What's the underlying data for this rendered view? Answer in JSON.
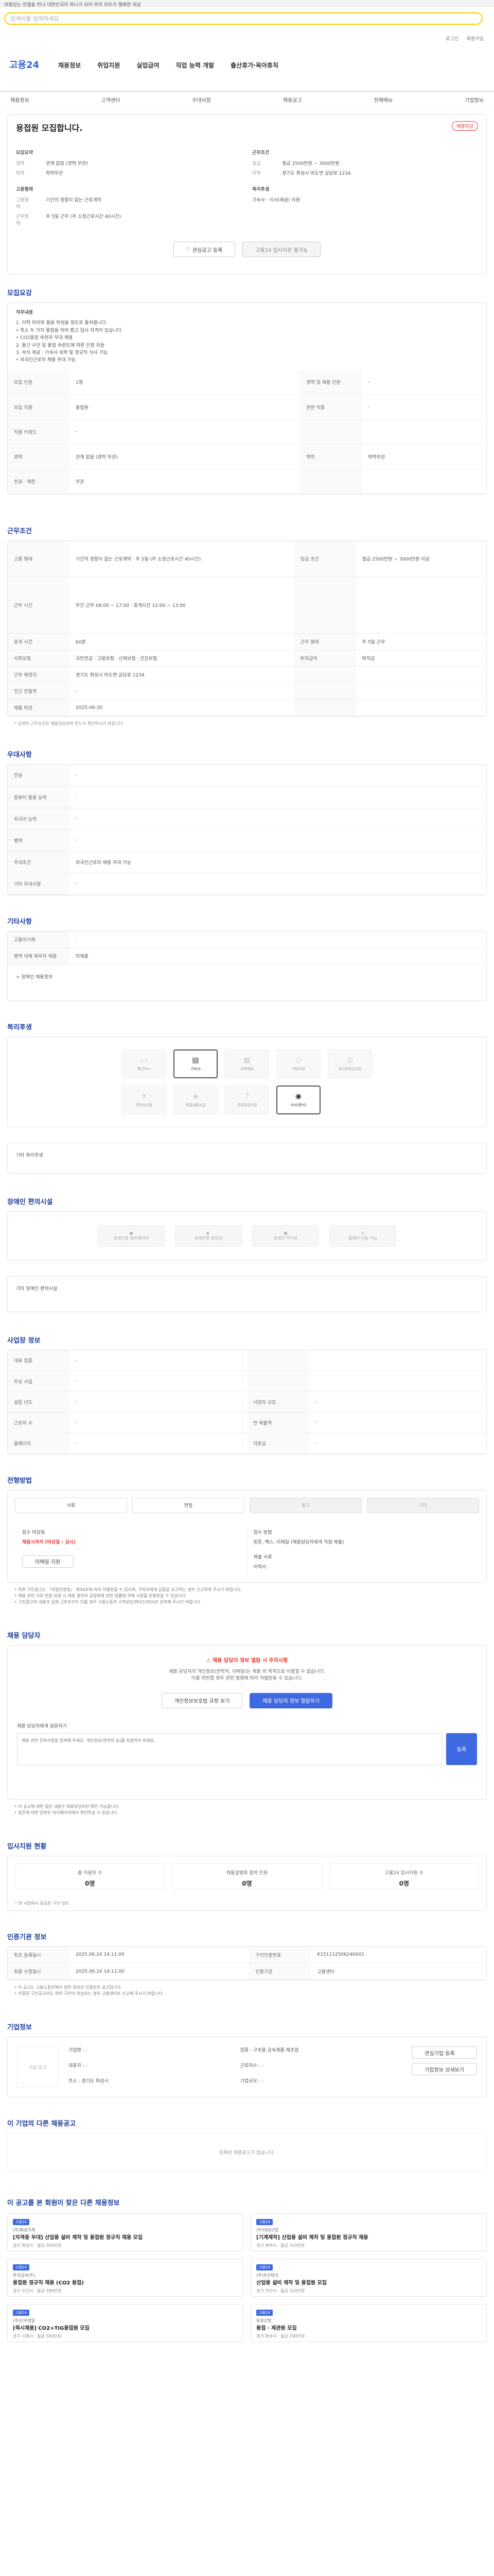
{
  "notice": "보람있는 연결을 만나 대한민국이 하나가 되어 우리 모두가 행복한 세상",
  "search": {
    "placeholder": "검색어를 입력하세요"
  },
  "util": [
    "로그인",
    "회원가입"
  ],
  "nav": {
    "logo": "고용24",
    "items": [
      "채용정보",
      "취업지원",
      "실업급여",
      "직업 능력 개발",
      "출산휴가·육아휴직"
    ],
    "sub": [
      "채용정보",
      "고객센터",
      "우대사항",
      "채용공고",
      "전체메뉴",
      "기업정보"
    ]
  },
  "summary": {
    "title": "용접원 모집합니다.",
    "badge": "채용마감",
    "left_head": "모집요약",
    "right_head": "근무조건",
    "left": [
      {
        "k": "경력",
        "v": "관계 없음 (경력 무관)"
      },
      {
        "k": "학력",
        "v": "학력무관"
      }
    ],
    "right": [
      {
        "k": "임금",
        "v": "월급 2500만원 ~ 3000만원"
      },
      {
        "k": "지역",
        "v": "경기도 화성시 마도면 금당로 1234"
      }
    ],
    "left2_head": "고용형태",
    "right2_head": "복리후생",
    "left2": [
      {
        "k": "고용형태",
        "v": "기간의 정함이 없는 근로계약"
      },
      {
        "k": "근무형태",
        "v": "주 5일 근무 (주 소정근로시간 40시간)"
      }
    ],
    "right2": [
      {
        "k": "",
        "v": "기숙사 · 식사(제공) 지원"
      }
    ],
    "btn_save": "관심공고 등록",
    "btn_apply": "고용24 입사지원 불가능"
  },
  "recruit": {
    "title": "모집요강",
    "body": [
      "직무내용",
      "1. 이력 허리와 몸을 뒤섞을 정도로 들쳐봅니다.",
      "• 최소 두 가지 용접을 하여 봤고 입사 자격이 있습니다.",
      "• CO2용접 숙련자 우대 채용",
      "2. 통근 수단 및 용접 숙련도에 따른 인정 차등",
      "3. 숙식 제공 : 기숙사 숙박 및 정규직 식사 가능",
      "• 외국인근로자 채용 우대 가능"
    ],
    "rows": [
      {
        "k1": "모집 인원",
        "v1": "1명",
        "k2": "경력 및 채용 인원",
        "v2": "-"
      },
      {
        "k1": "모집 직종",
        "v1": "용접원",
        "k2": "관련 직종",
        "v2": "-"
      },
      {
        "k1": "직종 키워드",
        "v1": "-",
        "k2": "",
        "v2": ""
      },
      {
        "k1": "경력",
        "v1": "관계 없음 (경력 무관)",
        "k2": "학력",
        "v2": "학력무관"
      },
      {
        "k1": "전공 · 제한",
        "v1": "무관",
        "k2": "",
        "v2": ""
      }
    ]
  },
  "conditions": {
    "title": "근무조건",
    "rows": [
      {
        "k1": "고용 형태",
        "v1": "기간의 정함이 없는 근로계약 · 주 5일 (주 소정근로시간 40시간)",
        "k2": "임금 조건",
        "v2": "월급 2500만원 ~ 3000만원 이상"
      },
      {
        "k1": "근무 시간",
        "v1": "주간 근무 08:00 ~ 17:00 · 휴게시간 12:00 ~ 13:00",
        "k2": "",
        "v2": ""
      },
      {
        "k1": "휴게 시간",
        "v1": "60분",
        "k2": "근무 형태",
        "v2": "주 5일 근무"
      },
      {
        "k1": "사회보험",
        "v1": "국민연금 · 고용보험 · 산재보험 · 건강보험",
        "k2": "퇴직급여",
        "v2": "퇴직금"
      },
      {
        "k1": "근무 예정지",
        "v1": "경기도 화성시 마도면 금당로 1234",
        "k2": "",
        "v2": ""
      },
      {
        "k1": "인근 전철역",
        "v1": "-",
        "k2": "",
        "v2": ""
      },
      {
        "k1": "채용 마감",
        "v1": "2025-06-30",
        "k2": "",
        "v2": ""
      }
    ],
    "note": "* 상세한 근무조건은 채용담당자와 반드시 확인하시기 바랍니다."
  },
  "preference": {
    "title": "우대사항",
    "rows": [
      {
        "k": "전공",
        "v": "-"
      },
      {
        "k": "컴퓨터 활용 능력",
        "v": "-"
      },
      {
        "k": "외국어 능력",
        "v": "-"
      },
      {
        "k": "병역",
        "v": "-"
      },
      {
        "k": "우대조건",
        "v": "외국인근로자 채용 우대 가능"
      },
      {
        "k": "기타 우대사항",
        "v": "-"
      }
    ]
  },
  "etc": {
    "title": "기타사항",
    "rows": [
      {
        "k": "고용허가제",
        "v": "-"
      },
      {
        "k": "병역 대체 복무자 채용",
        "v": "미채용"
      }
    ],
    "more": "+ 장애인 채용정보"
  },
  "welfare": {
    "title": "복리후생",
    "tiles": [
      {
        "icon": "car-icon",
        "glyph": "▭",
        "label": "통근버스",
        "on": false
      },
      {
        "icon": "bed-icon",
        "glyph": "▤",
        "label": "기숙사",
        "on": true
      },
      {
        "icon": "building-icon",
        "glyph": "▦",
        "label": "사택제공",
        "on": false
      },
      {
        "icon": "shield-icon",
        "glyph": "◇",
        "label": "식대지원",
        "on": false
      },
      {
        "icon": "person-icon",
        "glyph": "◎",
        "label": "자녀학자금지원",
        "on": false
      },
      {
        "icon": "plane-icon",
        "glyph": "✈",
        "label": "경조사지원",
        "on": false
      },
      {
        "icon": "gift-icon",
        "glyph": "◈",
        "label": "명절선물지급",
        "on": false
      },
      {
        "icon": "question-icon",
        "glyph": "?",
        "label": "건강검진지원",
        "on": false
      },
      {
        "icon": "meal-icon",
        "glyph": "◉",
        "label": "식사(중식)",
        "on": true
      }
    ],
    "detail_label": "기타 복리후생"
  },
  "accessibility": {
    "title": "장애인 편의시설",
    "tiles": [
      {
        "icon": "elevator-icon",
        "glyph": "▣",
        "label": "장애인용 엘리베이터"
      },
      {
        "icon": "toilet-icon",
        "glyph": "◐",
        "label": "장애인용 화장실"
      },
      {
        "icon": "parking-icon",
        "glyph": "▩",
        "label": "장애인 주차장"
      },
      {
        "icon": "wheelchair-icon",
        "glyph": "♿",
        "label": "휠체어 이동 가능"
      }
    ],
    "detail_label": "기타 장애인 편의시설"
  },
  "workplace": {
    "title": "사업장 정보",
    "rows": [
      {
        "k1": "대표 업종",
        "v1": "-",
        "k2": "",
        "v2": ""
      },
      {
        "k1": "주요 사업",
        "v1": "-",
        "k2": "",
        "v2": ""
      },
      {
        "k1": "설립 년도",
        "v1": "-",
        "k2": "사업자 규모",
        "v2": "-"
      },
      {
        "k1": "근로자 수",
        "v1": "-",
        "k2": "연 매출액",
        "v2": "-"
      },
      {
        "k1": "홈페이지",
        "v1": "-",
        "k2": "자본금",
        "v2": "-"
      }
    ]
  },
  "apply": {
    "title": "전형방법",
    "chips": [
      {
        "label": "서류",
        "off": false
      },
      {
        "label": "면접",
        "off": false
      },
      {
        "label": "필기",
        "off": true
      },
      {
        "label": "기타",
        "off": true
      }
    ],
    "col1_head": "접수 마감일",
    "col1_val": "채용시까지 (마감일 : 상시)",
    "col1_btn": "이메일 지원",
    "col2_head": "접수 방법",
    "col2_val": "방문, 팩스, 이메일 (채용담당자에게 직접 제출)",
    "col3_head": "제출 서류",
    "col3_val": "이력서",
    "bullets": [
      "• 허위 구인광고는 「직업안정법」 제34조에 따라 처벌받을 수 있으며, 구직자에게 금품을 요구하는 경우 신고하여 주시기 바랍니다.",
      "• 채용 관련 서류 반환 요청 시 채용 절차의 공정화에 관한 법률에 의해 서류를 반환받을 수 있습니다.",
      "• 구인광고의 내용과 실제 근로조건이 다를 경우 고용노동부 고객상담센터(1350)로 문의해 주시기 바랍니다."
    ]
  },
  "manager": {
    "title": "채용 담당자",
    "alert": "채용 담당자 정보 열람 시 주의사항",
    "sub1": "채용 담당자의 개인정보(연락처, 이메일)는 채용 외 목적으로 이용할 수 없습니다.",
    "sub2": "이를 위반할 경우 관련 법령에 따라 처벌받을 수 있습니다.",
    "btn1": "개인정보보호법 규정 보기",
    "btn2": "채용 담당자 정보 열람하기",
    "qna_label": "채용 담당자에게 질문하기",
    "qna_placeholder": "채용 관련 문의사항을 입력해 주세요. 개인정보(연락처 등)를 포함하지 마세요.",
    "qna_btn": "등록",
    "bullets": [
      "• 이 공고에 대한 질문 내용은 채용담당자만 확인 가능합니다.",
      "• 질문에 대한 답변은 마이페이지에서 확인하실 수 있습니다."
    ]
  },
  "status": {
    "title": "입사지원 현황",
    "stats": [
      {
        "label": "총 지원자 수",
        "value": "0명"
      },
      {
        "label": "채용설명회 참여 인원",
        "value": "0명"
      },
      {
        "label": "고용24 입사지원 수",
        "value": "0명"
      }
    ],
    "note": "* 현 시점에서 중요한 구인 정보"
  },
  "register": {
    "title": "인증기관 정보",
    "rows": [
      {
        "k1": "최초 등록일시",
        "v1": "2025.06.24 14:11:00",
        "k2": "구인인증번호",
        "v2": "K151112506240001"
      },
      {
        "k1": "최종 수정일시",
        "v1": "2025.06.24 14:11:00",
        "k2": "인증기관",
        "v2": "고용센터"
      }
    ],
    "bullets": [
      "• 이 공고는 고용노동부에서 정한 정보로 인증받은 공고입니다.",
      "• 인증된 구인공고라도 허위 구인이 의심되는 경우 고용센터로 신고해 주시기 바랍니다."
    ]
  },
  "company": {
    "title": "기업정보",
    "logo_alt": "기업 로고",
    "items": [
      {
        "k": "기업명",
        "v": "-"
      },
      {
        "k": "업종",
        "v": "구조용 금속제품 제조업"
      },
      {
        "k": "대표자",
        "v": "-"
      },
      {
        "k": "근로자수",
        "v": "-"
      },
      {
        "k": "주소",
        "v": "경기도 화성시"
      },
      {
        "k": "기업규모",
        "v": "-"
      }
    ],
    "btn1": "관심기업 등록",
    "btn2": "기업정보 상세보기"
  },
  "other_jobs": {
    "title": "이 기업의 다른 채용공고",
    "empty": "등록된 채용공고가 없습니다."
  },
  "recommend": {
    "title": "이 공고를 본 회원이 찾은 다른 채용정보",
    "items": [
      {
        "tag": "고용24",
        "company": "(주)화성기계",
        "name": "[자격증 우대] 산업용 설비 제작 및 용접원 정규직 채용 모집",
        "meta": "경기 화성시 · 월급 300만원"
      },
      {
        "tag": "고용24",
        "company": "(주)대성산업",
        "name": "[기계제작] 산업용 설비 제작 및 용접원 정규직 채용",
        "meta": "경기 평택시 · 월급 320만원"
      },
      {
        "tag": "고용24",
        "company": "한국금속(주)",
        "name": "용접원 정규직 채용 (CO2 용접)",
        "meta": "경기 오산시 · 월급 280만원"
      },
      {
        "tag": "고용24",
        "company": "(주)우진테크",
        "name": "산업용 설비 제작 및 용접원 모집",
        "meta": "경기 안산시 · 월급 310만원"
      },
      {
        "tag": "고용24",
        "company": "(주)신우정밀",
        "name": "[즉시채용] CO2+TIG용접원 모집",
        "meta": "경기 시흥시 · 월급 300만원"
      },
      {
        "tag": "고용24",
        "company": "동양산업",
        "name": "용접 · 제관원 모집",
        "meta": "경기 화성시 · 월급 290만원"
      }
    ]
  }
}
